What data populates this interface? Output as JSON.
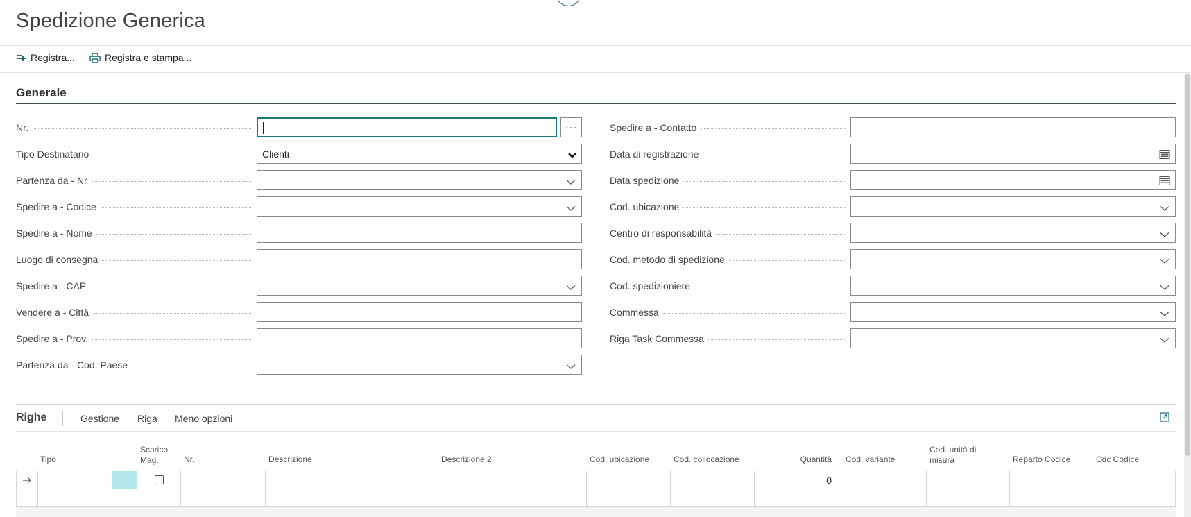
{
  "page": {
    "title": "Spedizione Generica"
  },
  "actions": {
    "post": "Registra...",
    "post_print": "Registra e stampa..."
  },
  "general": {
    "title": "Generale",
    "left_fields": [
      {
        "label": "Nr.",
        "value": ""
      },
      {
        "label": "Tipo Destinatario",
        "value": "Clienti"
      },
      {
        "label": "Partenza da - Nr",
        "value": ""
      },
      {
        "label": "Spedire a - Codice",
        "value": ""
      },
      {
        "label": "Spedire a - Nome",
        "value": ""
      },
      {
        "label": "Luogo di consegna",
        "value": ""
      },
      {
        "label": "Spedire a - CAP",
        "value": ""
      },
      {
        "label": "Vendere a - Città",
        "value": ""
      },
      {
        "label": "Spedire a - Prov.",
        "value": ""
      },
      {
        "label": "Partenza da - Cod. Paese",
        "value": ""
      }
    ],
    "right_fields": [
      {
        "label": "Spedire a - Contatto",
        "value": ""
      },
      {
        "label": "Data di registrazione",
        "value": ""
      },
      {
        "label": "Data spedizione",
        "value": ""
      },
      {
        "label": "Cod. ubicazione",
        "value": ""
      },
      {
        "label": "Centro di responsabilità",
        "value": ""
      },
      {
        "label": "Cod. metodo di spedizione",
        "value": ""
      },
      {
        "label": "Cod. spedizioniere",
        "value": ""
      },
      {
        "label": "Commessa",
        "value": ""
      },
      {
        "label": "Riga Task Commessa",
        "value": ""
      }
    ],
    "dots_button": "···"
  },
  "lines": {
    "title": "Righe",
    "tabs": [
      "Gestione",
      "Riga",
      "Meno opzioni"
    ],
    "columns": [
      {
        "label": "Tipo"
      },
      {
        "label": "Scarico Mag."
      },
      {
        "label": "Nr."
      },
      {
        "label": "Descrizione"
      },
      {
        "label": "Descrizione 2"
      },
      {
        "label": "Cod. ubicazione"
      },
      {
        "label": "Cod. collocazione"
      },
      {
        "label": "Quantità"
      },
      {
        "label": "Cod. variante"
      },
      {
        "label": "Cod. unità di misura"
      },
      {
        "label": "Reparto Codice"
      },
      {
        "label": "Cdc Codice"
      }
    ],
    "row1_quantity": "0"
  },
  "colors": {
    "accent": "#1d7a7a",
    "selected_cell": "#b3e6e8",
    "border": "#8a8a8a"
  }
}
